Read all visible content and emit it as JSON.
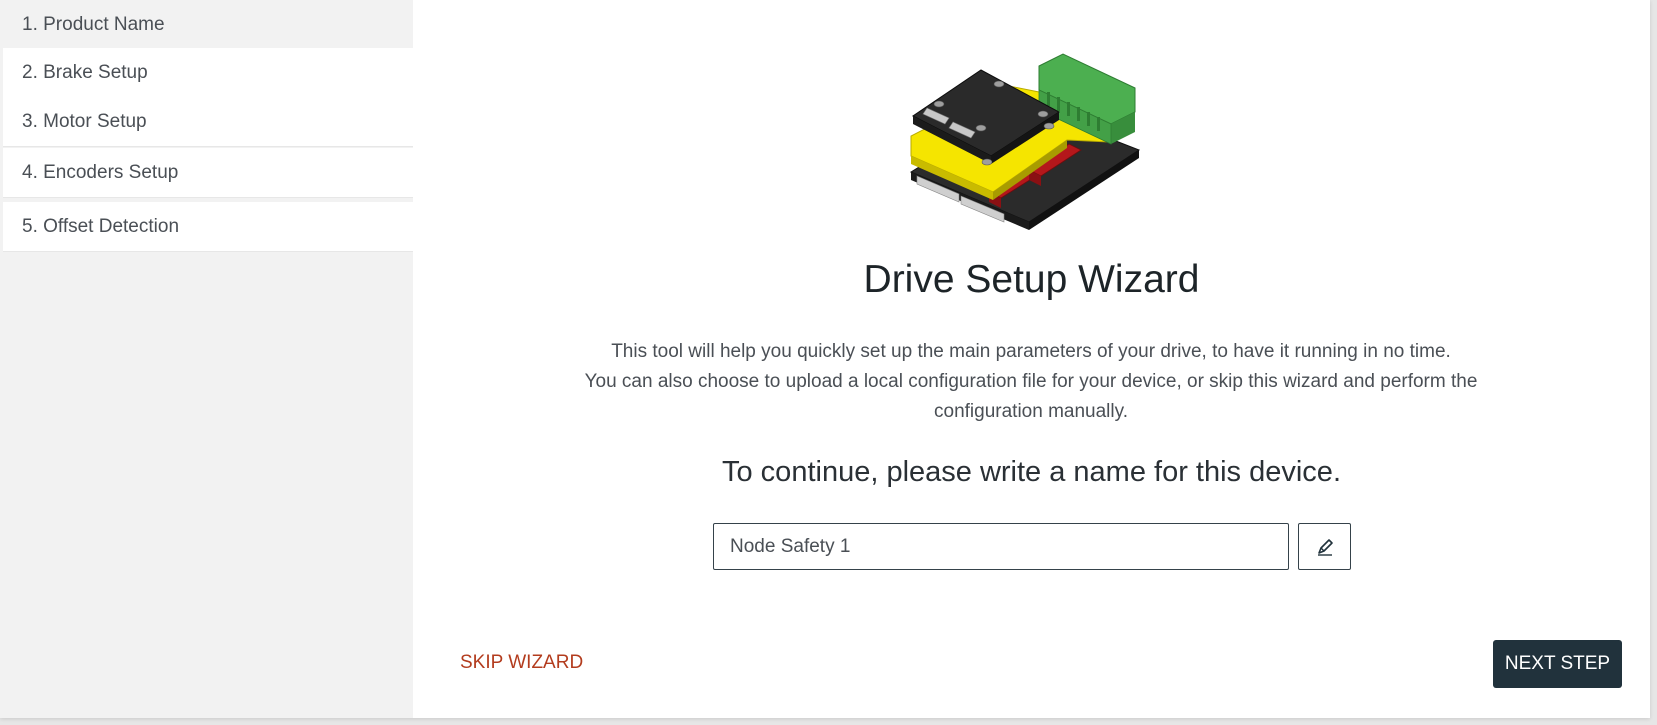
{
  "sidebar": {
    "steps": [
      {
        "label": "1. Product Name"
      },
      {
        "label": "2. Brake Setup"
      },
      {
        "label": "3. Motor Setup"
      },
      {
        "label": "4. Encoders Setup"
      },
      {
        "label": "5. Offset Detection"
      }
    ],
    "active_step": 0
  },
  "main": {
    "title": "Drive Setup Wizard",
    "description_lines": [
      "This tool will help you quickly set up the main parameters of your drive, to have it running in no time.",
      "You can also choose to upload a local configuration file for your device, or skip this wizard and perform the configuration manually."
    ],
    "prompt": "To continue, please write a name for this device.",
    "name_input": {
      "value": "Node Safety 1"
    },
    "edit_icon": "pen-icon",
    "skip_label": "SKIP WIZARD",
    "next_label": "NEXT STEP"
  },
  "colors": {
    "primary": "#21323c",
    "skip": "#b33c1e",
    "sidebar_bg": "#f2f2f2"
  }
}
